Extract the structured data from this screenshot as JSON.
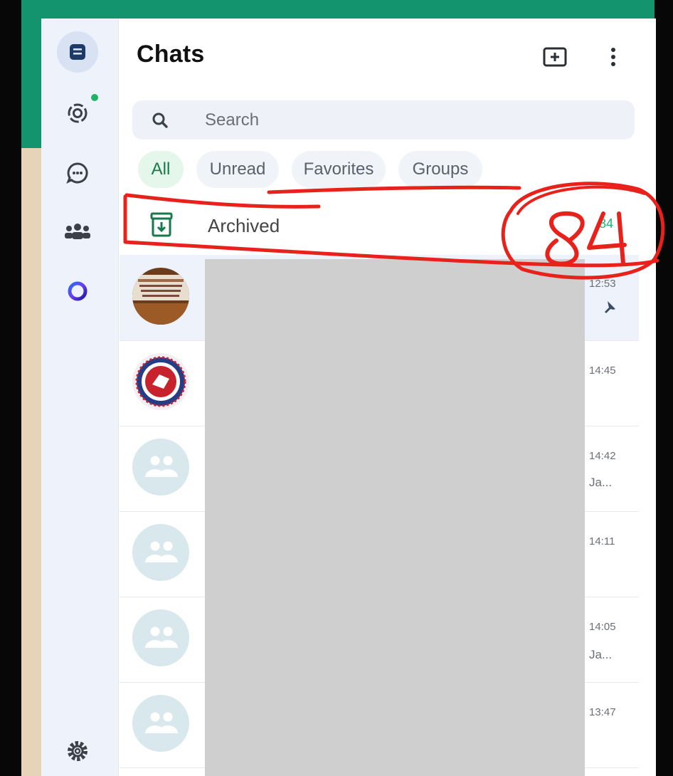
{
  "header": {
    "title": "Chats"
  },
  "search": {
    "placeholder": "Search"
  },
  "filters": [
    {
      "label": "All",
      "active": true
    },
    {
      "label": "Unread",
      "active": false
    },
    {
      "label": "Favorites",
      "active": false
    },
    {
      "label": "Groups",
      "active": false
    }
  ],
  "archived": {
    "label": "Archived",
    "count": "84"
  },
  "chats": [
    {
      "time": "12:53",
      "snippet": "",
      "pinned": true,
      "avatar": "photo-banner"
    },
    {
      "time": "14:45",
      "snippet": "",
      "pinned": false,
      "avatar": "emblem"
    },
    {
      "time": "14:42",
      "snippet": "Ja...",
      "pinned": false,
      "avatar": "group-default"
    },
    {
      "time": "14:11",
      "snippet": "",
      "pinned": false,
      "avatar": "group-default"
    },
    {
      "time": "14:05",
      "snippet": "Ja...",
      "pinned": false,
      "avatar": "group-default"
    },
    {
      "time": "13:47",
      "snippet": "",
      "pinned": false,
      "avatar": "group-default"
    }
  ],
  "colors": {
    "brand": "#14936f",
    "accent_green": "#21b26a",
    "annotation_red": "#e8221b",
    "redaction": "#cfcfcf"
  },
  "icons": {
    "rail": [
      "chats-icon",
      "status-icon",
      "channels-icon",
      "communities-icon",
      "meta-ai-icon",
      "settings-icon"
    ],
    "header": [
      "new-chat-icon",
      "menu-icon"
    ]
  }
}
